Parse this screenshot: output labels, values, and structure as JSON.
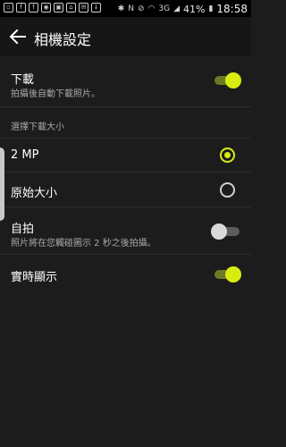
{
  "status_bar": {
    "battery_percent": "41%",
    "time": "18:58",
    "network": "3G"
  },
  "header": {
    "title": "相機設定"
  },
  "settings": {
    "download": {
      "label": "下載",
      "description": "拍攝後自動下載照片。",
      "enabled": true
    },
    "download_size_section": {
      "label": "選擇下載大小"
    },
    "size_options": [
      {
        "label": "2 MP",
        "selected": true
      },
      {
        "label": "原始大小",
        "selected": false
      }
    ],
    "selfie": {
      "label": "自拍",
      "description": "照片將在您觸碰圖示 2 秒之後拍攝。",
      "enabled": false
    },
    "live_view": {
      "label": "實時顯示",
      "enabled": true
    }
  },
  "colors": {
    "accent": "#d9ec10",
    "background": "#1c1c1c"
  }
}
